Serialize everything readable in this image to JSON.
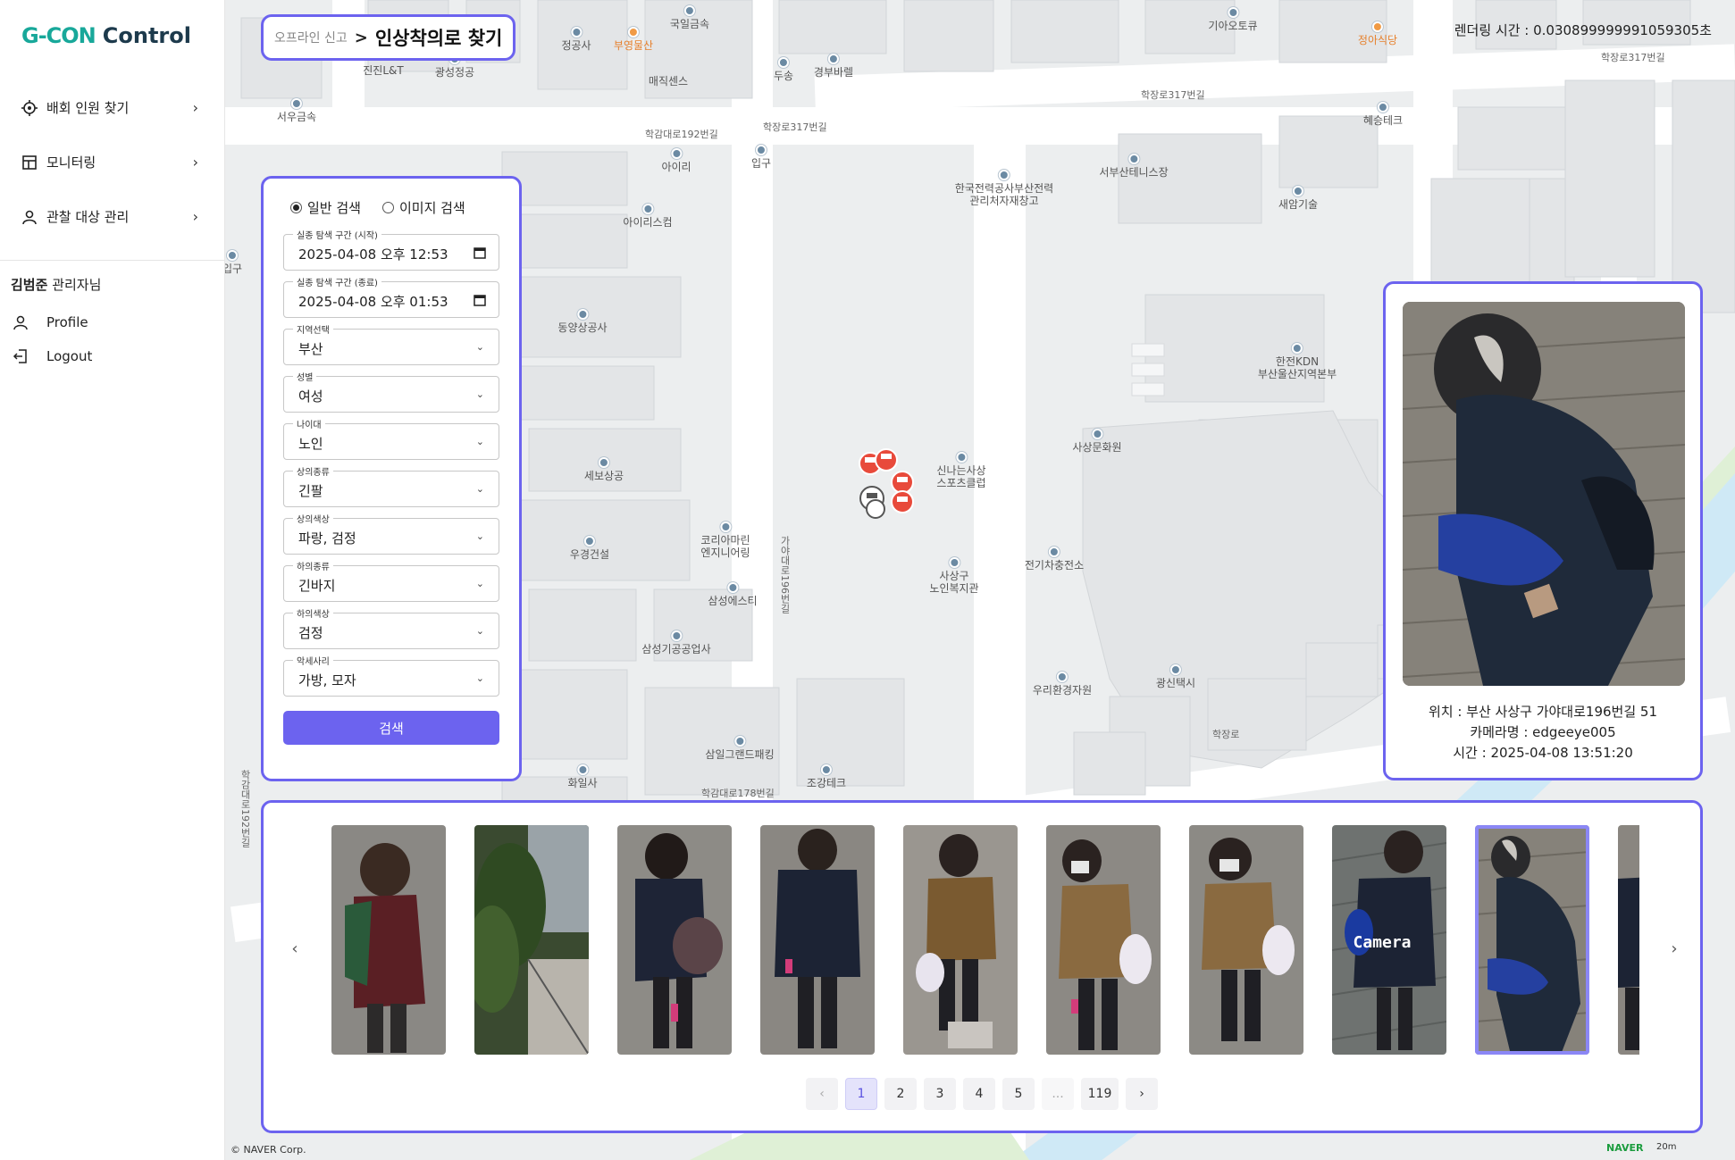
{
  "app": {
    "brand": "G-CON",
    "suffix": "Control"
  },
  "sidebar": {
    "items": [
      {
        "label": "배회 인원 찾기",
        "icon": "target-icon"
      },
      {
        "label": "모니터링",
        "icon": "layout-icon"
      },
      {
        "label": "관찰 대상 관리",
        "icon": "user-icon"
      }
    ],
    "user": {
      "name": "김범준",
      "role": "관리자님"
    },
    "links": [
      {
        "label": "Profile",
        "icon": "person-icon"
      },
      {
        "label": "Logout",
        "icon": "logout-icon"
      }
    ]
  },
  "breadcrumb": {
    "parent": "오프라인 신고",
    "separator": ">",
    "current": "인상착의로 찾기"
  },
  "render_time": "렌더링 시간 : 0.030899999991059305초",
  "search": {
    "modes": [
      {
        "label": "일반 검색",
        "selected": true
      },
      {
        "label": "이미지 검색",
        "selected": false
      }
    ],
    "fields": [
      {
        "label": "실종 탐색 구간 (시작)",
        "value": "2025-04-08 오후 12:53",
        "type": "date"
      },
      {
        "label": "실종 탐색 구간 (종료)",
        "value": "2025-04-08 오후 01:53",
        "type": "date"
      },
      {
        "label": "지역선택",
        "value": "부산",
        "type": "select"
      },
      {
        "label": "성별",
        "value": "여성",
        "type": "select"
      },
      {
        "label": "나이대",
        "value": "노인",
        "type": "select"
      },
      {
        "label": "상의종류",
        "value": "긴팔",
        "type": "select"
      },
      {
        "label": "상의색상",
        "value": "파랑, 검정",
        "type": "select"
      },
      {
        "label": "하의종류",
        "value": "긴바지",
        "type": "select"
      },
      {
        "label": "하의색상",
        "value": "검정",
        "type": "select"
      },
      {
        "label": "악세사리",
        "value": "가방, 모자",
        "type": "select"
      }
    ],
    "submit_label": "검색"
  },
  "detail": {
    "location": "위치 : 부산 사상구 가야대로196번길 51",
    "camera": "카메라명 : edgeeye005",
    "time": "시간 : 2025-04-08 13:51:20"
  },
  "carousel": {
    "prev_icon": "‹",
    "next_icon": "›",
    "thumbnails": [
      {
        "id": 1,
        "selected": false,
        "overlay": ""
      },
      {
        "id": 2,
        "selected": false,
        "overlay": ""
      },
      {
        "id": 3,
        "selected": false,
        "overlay": ""
      },
      {
        "id": 4,
        "selected": false,
        "overlay": ""
      },
      {
        "id": 5,
        "selected": false,
        "overlay": ""
      },
      {
        "id": 6,
        "selected": false,
        "overlay": ""
      },
      {
        "id": 7,
        "selected": false,
        "overlay": ""
      },
      {
        "id": 8,
        "selected": false,
        "overlay": "Camera"
      },
      {
        "id": 9,
        "selected": true,
        "overlay": ""
      },
      {
        "id": 10,
        "selected": false,
        "overlay": ""
      }
    ]
  },
  "pagination": {
    "prev": "‹",
    "pages": [
      "1",
      "2",
      "3",
      "4",
      "5"
    ],
    "active": "1",
    "ellipsis": "...",
    "last": "119",
    "next": "›"
  },
  "map": {
    "pois": [
      {
        "label": "정공사",
        "orange": false
      },
      {
        "label": "부영물산",
        "orange": true
      },
      {
        "label": "국일금속",
        "orange": false
      },
      {
        "label": "진진L&T",
        "orange": false
      },
      {
        "label": "광성정공",
        "orange": false
      },
      {
        "label": "매직센스",
        "orange": false
      },
      {
        "label": "두송",
        "orange": false
      },
      {
        "label": "경부바렐",
        "orange": false
      },
      {
        "label": "기아오토큐",
        "orange": false
      },
      {
        "label": "정아식당",
        "orange": true
      },
      {
        "label": "서우금속",
        "orange": false
      },
      {
        "label": "아이리",
        "orange": false
      },
      {
        "label": "입구",
        "orange": false
      },
      {
        "label": "한국전력공사부산전력\n관리처자재창고",
        "orange": false
      },
      {
        "label": "서부산테니스장",
        "orange": false
      },
      {
        "label": "새암기술",
        "orange": false
      },
      {
        "label": "혜승테크",
        "orange": false
      },
      {
        "label": "아이리스컴",
        "orange": false
      },
      {
        "label": "입구",
        "orange": false
      },
      {
        "label": "동양상공사",
        "orange": false
      },
      {
        "label": "한전KDN\n부산울산지역본부",
        "orange": false
      },
      {
        "label": "세보상공",
        "orange": false
      },
      {
        "label": "신나는사상\n스포츠클럽",
        "orange": false
      },
      {
        "label": "사상문화원",
        "orange": false
      },
      {
        "label": "우경건설",
        "orange": false
      },
      {
        "label": "코리아마린\n엔지니어링",
        "orange": false
      },
      {
        "label": "전기차충전소",
        "orange": false
      },
      {
        "label": "사상구\n노인복지관",
        "orange": false
      },
      {
        "label": "삼성에스티",
        "orange": false
      },
      {
        "label": "삼성기공공업사",
        "orange": false
      },
      {
        "label": "우리환경자원",
        "orange": false
      },
      {
        "label": "광신택시",
        "orange": false
      },
      {
        "label": "삼일그랜드패킹",
        "orange": false
      },
      {
        "label": "화일사",
        "orange": false
      },
      {
        "label": "조강테크",
        "orange": false
      }
    ],
    "roads": [
      "학장로317번길",
      "학장로317번길",
      "학장로317번길",
      "학감대로192번길",
      "가야대로196번길",
      "학감대로178번길",
      "학장로",
      "학감대로192번길"
    ],
    "attribution": "© NAVER Corp.",
    "provider": "NAVER",
    "scale": "20m"
  }
}
